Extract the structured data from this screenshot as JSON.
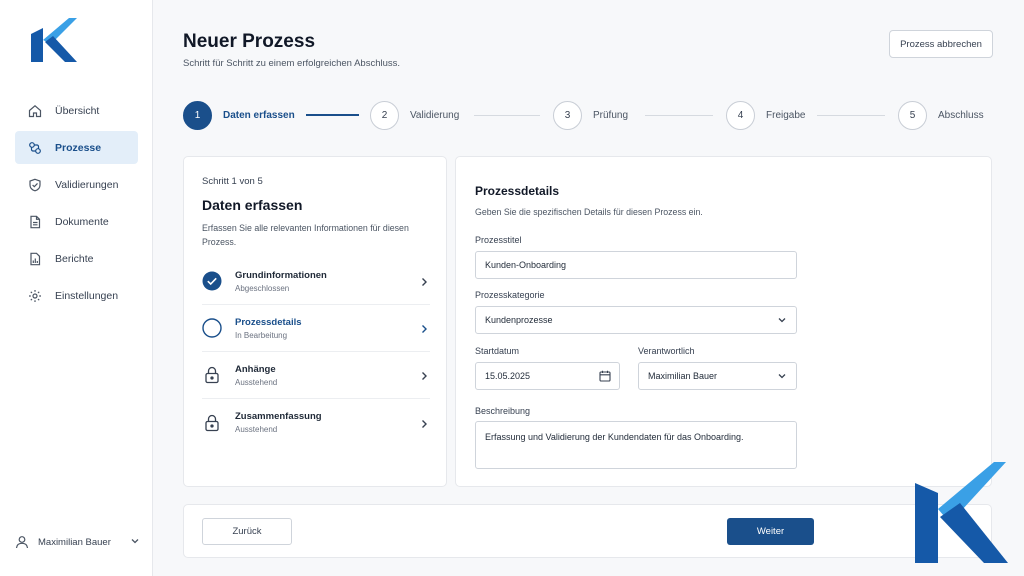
{
  "sidebar": {
    "items": [
      {
        "label": "Übersicht",
        "icon": "home-icon"
      },
      {
        "label": "Prozesse",
        "icon": "workflow-icon",
        "active": true
      },
      {
        "label": "Validierungen",
        "icon": "shield-check-icon"
      },
      {
        "label": "Dokumente",
        "icon": "document-icon"
      },
      {
        "label": "Berichte",
        "icon": "chart-icon"
      },
      {
        "label": "Einstellungen",
        "icon": "gear-icon"
      }
    ],
    "user": {
      "name": "Maximilian Bauer"
    }
  },
  "header": {
    "title": "Neuer Prozess",
    "subtitle": "Schritt für Schritt zu einem erfolgreichen Abschluss.",
    "cancel_label": "Prozess abbrechen"
  },
  "stepper": {
    "steps": [
      {
        "number": "1",
        "label": "Daten erfassen"
      },
      {
        "number": "2",
        "label": "Validierung"
      },
      {
        "number": "3",
        "label": "Prüfung"
      },
      {
        "number": "4",
        "label": "Freigabe"
      },
      {
        "number": "5",
        "label": "Abschluss"
      }
    ]
  },
  "left_card": {
    "step_count": "Schritt 1 von 5",
    "title": "Daten erfassen",
    "description": "Erfassen Sie alle relevanten Informationen für diesen Prozess.",
    "substeps": [
      {
        "title": "Grundinformationen",
        "status": "Abgeschlossen"
      },
      {
        "title": "Prozessdetails",
        "status": "In Bearbeitung"
      },
      {
        "title": "Anhänge",
        "status": "Ausstehend"
      },
      {
        "title": "Zusammenfassung",
        "status": "Ausstehend"
      }
    ]
  },
  "form": {
    "title": "Prozessdetails",
    "description": "Geben Sie die spezifischen Details für diesen Prozess ein.",
    "fields": {
      "titel": {
        "label": "Prozesstitel",
        "value": "Kunden-Onboarding"
      },
      "kategorie": {
        "label": "Prozesskategorie",
        "value": "Kundenprozesse"
      },
      "startdatum": {
        "label": "Startdatum",
        "value": "15.05.2025"
      },
      "verantwortlich": {
        "label": "Verantwortlich",
        "value": "Maximilian Bauer"
      },
      "beschreibung": {
        "label": "Beschreibung",
        "value": "Erfassung und Validierung der Kundendaten für das Onboarding."
      }
    }
  },
  "footer": {
    "back_label": "Zurück",
    "next_label": "Weiter"
  },
  "colors": {
    "accent": "#1a4f8b",
    "logo_light": "#3aa0e6",
    "logo_dark": "#1559a8"
  }
}
